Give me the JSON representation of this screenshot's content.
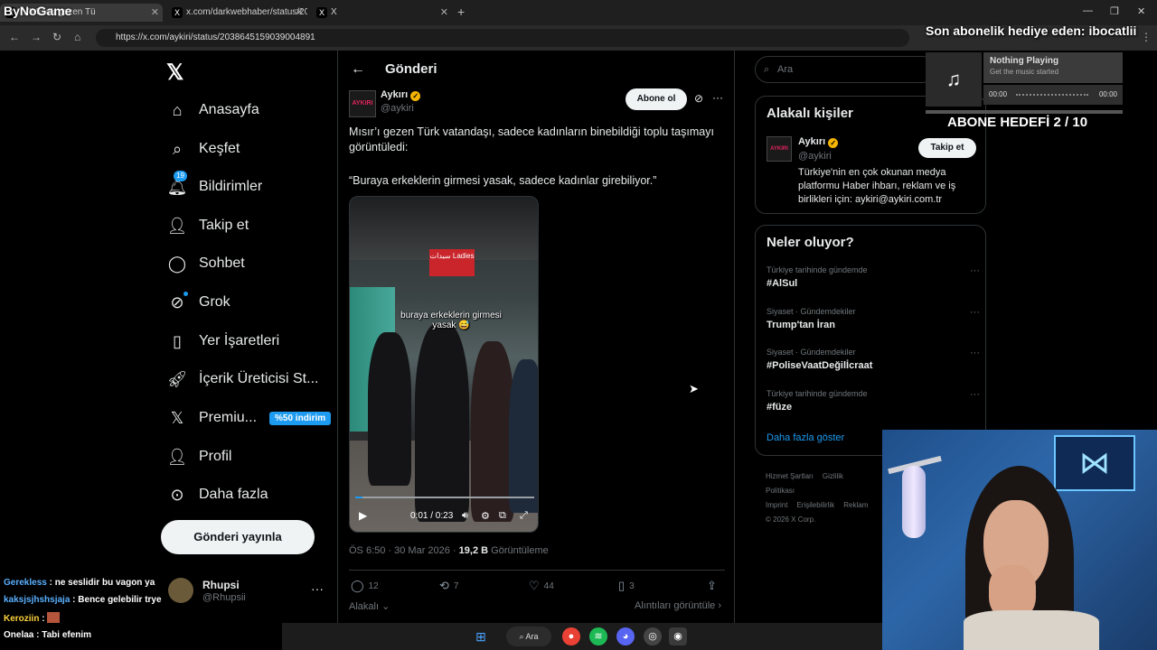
{
  "browser": {
    "tabs": [
      {
        "label": "r: \"Mısır'ı gezen Tü"
      },
      {
        "label": "x.com/darkwebhaber/status/20"
      },
      {
        "label": "X"
      }
    ],
    "new_tab_symbol": "+",
    "url": "https://x.com/aykiri/status/2038645159039004891"
  },
  "overlay": {
    "brand": "ByNoGame",
    "sub_banner": "Son abonelik hediye eden: ibocatlii",
    "music": {
      "title": "Nothing Playing",
      "subtitle": "Get the music started",
      "time_start": "00:00",
      "time_end": "00:00"
    },
    "goal": "ABONE HEDEFİ 2 / 10"
  },
  "nav": {
    "items": [
      {
        "label": "Anasayfa",
        "icon": "home-icon"
      },
      {
        "label": "Keşfet",
        "icon": "search-icon"
      },
      {
        "label": "Bildirimler",
        "icon": "bell-icon",
        "badge": "19"
      },
      {
        "label": "Takip et",
        "icon": "follow-icon"
      },
      {
        "label": "Sohbet",
        "icon": "chat-icon"
      },
      {
        "label": "Grok",
        "icon": "grok-icon"
      },
      {
        "label": "Yer İşaretleri",
        "icon": "bookmark-icon"
      },
      {
        "label": "İçerik Üreticisi St...",
        "icon": "rocket-icon"
      },
      {
        "label": "Premiu...",
        "icon": "x-icon",
        "pill": "%50 indirim"
      },
      {
        "label": "Profil",
        "icon": "profile-icon"
      },
      {
        "label": "Daha fazla",
        "icon": "more-icon"
      }
    ],
    "post_button": "Gönderi yayınla",
    "account": {
      "name": "Rhupsi",
      "handle": "@Rhupsii"
    }
  },
  "chat": [
    {
      "user": "Gerekless",
      "text": ": ne seslidir bu vagon ya"
    },
    {
      "user": "kaksjsjhshsjaja",
      "text": ": Bence gelebilir trye"
    },
    {
      "user": "Keroziin",
      "text": ":"
    },
    {
      "user": "Onelaa",
      "text": ": Tabi efenim"
    }
  ],
  "post": {
    "page_title": "Gönderi",
    "author": {
      "name": "Aykırı",
      "handle": "@aykiri",
      "logo_text": "AYKIRI"
    },
    "subscribe_label": "Abone ol",
    "text": "Mısır’ı gezen Türk vatandaşı, sadece kadınların binebildiği toplu taşımayı görüntüledi:",
    "quote": "“Buraya erkeklerin girmesi yasak, sadece kadınlar girebiliyor.”",
    "video": {
      "caption": "buraya erkeklerin girmesi yasak 😅",
      "sign_text": "سيدات Ladies",
      "time": "0:01 / 0:23",
      "progress": 0.04
    },
    "meta": {
      "time": "ÖS 6:50 · 30 Mar 2026 · ",
      "views": "19,2 B",
      "views_label": " Görüntüleme"
    },
    "actions": {
      "replies": "12",
      "reposts": "7",
      "likes": "44",
      "bookmarks": "3"
    },
    "sort_label": "Alakalı",
    "quotes_label": "Alıntıları görüntüle"
  },
  "sidebar": {
    "search_placeholder": "Ara",
    "people": {
      "title": "Alakalı kişiler",
      "name": "Aykırı",
      "handle": "@aykiri",
      "follow_label": "Takip et",
      "bio": "Türkiye'nin en çok okunan medya platformu Haber ihbarı, reklam ve iş birlikleri için: aykiri@aykiri.com.tr"
    },
    "trends": {
      "title": "Neler oluyor?",
      "items": [
        {
          "context": "Türkiye tarihinde gündemde",
          "name": "#AlSul"
        },
        {
          "context": "Siyaset · Gündemdekiler",
          "name": "Trump'tan İran"
        },
        {
          "context": "Siyaset · Gündemdekiler",
          "name": "#PoliseVaatDeğilİcraat"
        },
        {
          "context": "Türkiye tarihinde gündemde",
          "name": "#füze"
        }
      ],
      "show_more": "Daha fazla göster"
    },
    "footer": [
      "Hizmet Şartları",
      "Gizlilik Politikası",
      "Imprint",
      "Erişilebilirlik",
      "Reklam",
      "© 2026 X Corp."
    ]
  },
  "taskbar": {
    "search_label": "Ara"
  }
}
